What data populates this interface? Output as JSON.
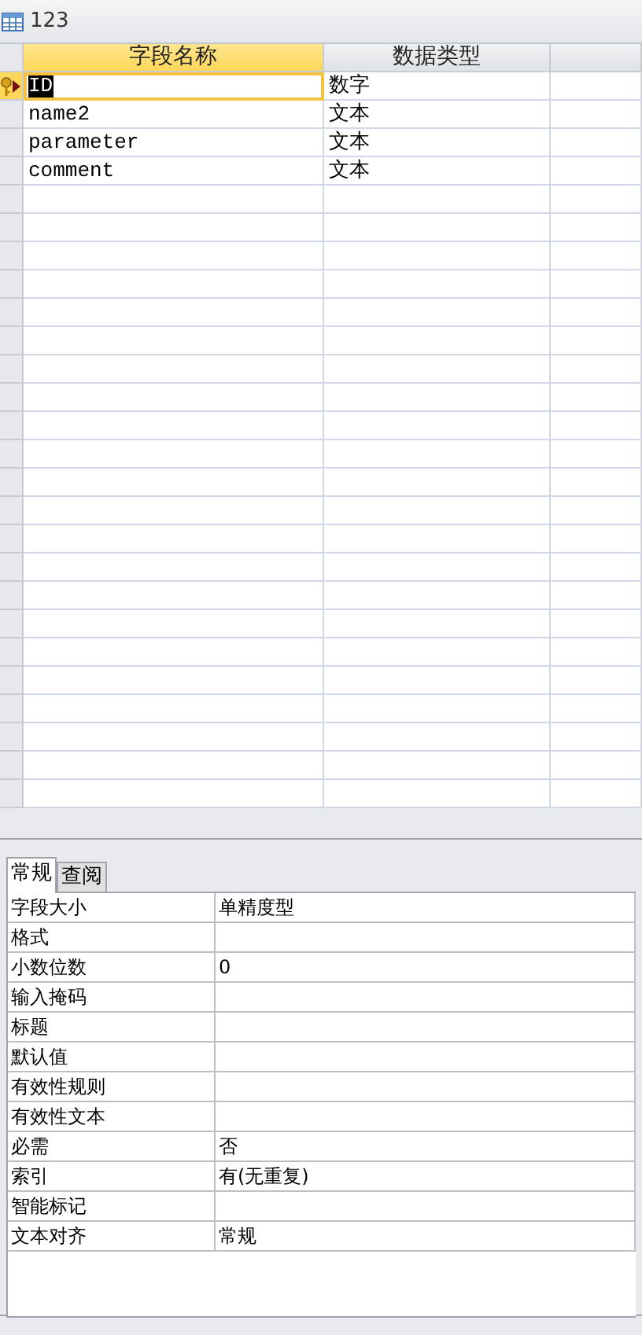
{
  "window": {
    "title": "123"
  },
  "grid": {
    "columns": [
      {
        "label": "字段名称",
        "selected": true
      },
      {
        "label": "数据类型",
        "selected": false
      }
    ],
    "rows": [
      {
        "name": "ID",
        "type": "数字",
        "primary_key": true,
        "current": true
      },
      {
        "name": "name2",
        "type": "文本",
        "primary_key": false,
        "current": false
      },
      {
        "name": "parameter",
        "type": "文本",
        "primary_key": false,
        "current": false
      },
      {
        "name": "comment",
        "type": "文本",
        "primary_key": false,
        "current": false
      }
    ]
  },
  "properties": {
    "tabs": [
      {
        "label": "常规",
        "selected": true
      },
      {
        "label": "查阅",
        "selected": false
      }
    ],
    "rows": [
      {
        "label": "字段大小",
        "value": "单精度型"
      },
      {
        "label": "格式"
      },
      {
        "label": "小数位数",
        "value": "0"
      },
      {
        "label": "输入掩码"
      },
      {
        "label": "标题"
      },
      {
        "label": "默认值"
      },
      {
        "label": "有效性规则"
      },
      {
        "label": "有效性文本"
      },
      {
        "label": "必需",
        "value": "否"
      },
      {
        "label": "索引",
        "value": "有(无重复)"
      },
      {
        "label": "智能标记"
      },
      {
        "label": "文本对齐",
        "value": "常规"
      }
    ]
  }
}
